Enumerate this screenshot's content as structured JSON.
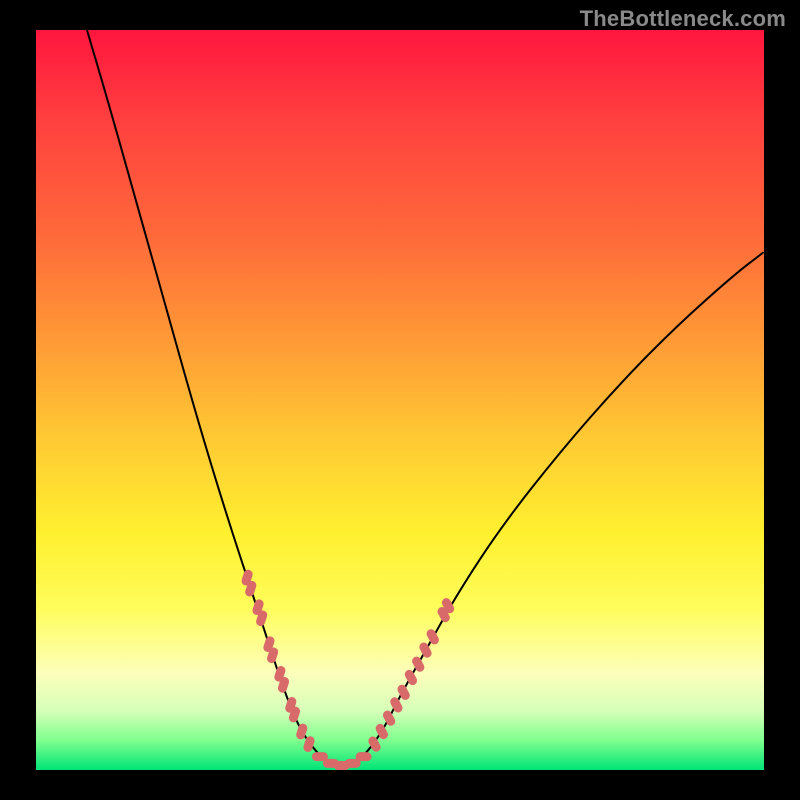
{
  "watermark": {
    "text": "TheBottleneck.com"
  },
  "colors": {
    "curve_stroke": "#000000",
    "marker_fill": "#d86a6a",
    "marker_stroke": "#d86a6a"
  },
  "chart_data": {
    "type": "line",
    "title": "",
    "xlabel": "",
    "ylabel": "",
    "xlim": [
      0,
      100
    ],
    "ylim": [
      0,
      100
    ],
    "curve": [
      {
        "x": 7,
        "y": 100
      },
      {
        "x": 10,
        "y": 90
      },
      {
        "x": 14,
        "y": 76
      },
      {
        "x": 18,
        "y": 62
      },
      {
        "x": 22,
        "y": 48
      },
      {
        "x": 26,
        "y": 35
      },
      {
        "x": 30,
        "y": 23
      },
      {
        "x": 32,
        "y": 17
      },
      {
        "x": 34,
        "y": 11
      },
      {
        "x": 36,
        "y": 6
      },
      {
        "x": 38,
        "y": 3
      },
      {
        "x": 40,
        "y": 1
      },
      {
        "x": 42,
        "y": 0.5
      },
      {
        "x": 44,
        "y": 1
      },
      {
        "x": 46,
        "y": 3
      },
      {
        "x": 48,
        "y": 6
      },
      {
        "x": 50,
        "y": 10
      },
      {
        "x": 54,
        "y": 17
      },
      {
        "x": 58,
        "y": 24
      },
      {
        "x": 64,
        "y": 33
      },
      {
        "x": 72,
        "y": 43
      },
      {
        "x": 80,
        "y": 52
      },
      {
        "x": 88,
        "y": 60
      },
      {
        "x": 96,
        "y": 67
      },
      {
        "x": 100,
        "y": 70
      }
    ],
    "markers": [
      {
        "x": 29,
        "y": 26,
        "shape": "round"
      },
      {
        "x": 29.5,
        "y": 24.5,
        "shape": "round"
      },
      {
        "x": 30.5,
        "y": 22,
        "shape": "round"
      },
      {
        "x": 31,
        "y": 20.5,
        "shape": "round"
      },
      {
        "x": 32,
        "y": 17,
        "shape": "round"
      },
      {
        "x": 32.5,
        "y": 15.5,
        "shape": "round"
      },
      {
        "x": 33.5,
        "y": 13,
        "shape": "round"
      },
      {
        "x": 34,
        "y": 11.5,
        "shape": "round"
      },
      {
        "x": 35,
        "y": 8.8,
        "shape": "round"
      },
      {
        "x": 35.5,
        "y": 7.5,
        "shape": "round"
      },
      {
        "x": 36.5,
        "y": 5.2,
        "shape": "round"
      },
      {
        "x": 37.5,
        "y": 3.5,
        "shape": "round"
      },
      {
        "x": 39,
        "y": 1.8,
        "shape": "round"
      },
      {
        "x": 40.5,
        "y": 0.9,
        "shape": "round"
      },
      {
        "x": 42,
        "y": 0.6,
        "shape": "round"
      },
      {
        "x": 43.5,
        "y": 0.9,
        "shape": "round"
      },
      {
        "x": 45,
        "y": 1.8,
        "shape": "round"
      },
      {
        "x": 46.5,
        "y": 3.5,
        "shape": "round"
      },
      {
        "x": 47.5,
        "y": 5.2,
        "shape": "round"
      },
      {
        "x": 48.5,
        "y": 7,
        "shape": "round"
      },
      {
        "x": 49.5,
        "y": 8.8,
        "shape": "round"
      },
      {
        "x": 50.5,
        "y": 10.5,
        "shape": "round"
      },
      {
        "x": 51.5,
        "y": 12.5,
        "shape": "round"
      },
      {
        "x": 52.5,
        "y": 14.3,
        "shape": "round"
      },
      {
        "x": 53.5,
        "y": 16.2,
        "shape": "round"
      },
      {
        "x": 54.5,
        "y": 18,
        "shape": "round"
      },
      {
        "x": 56,
        "y": 21,
        "shape": "round"
      },
      {
        "x": 56.6,
        "y": 22.2,
        "shape": "round"
      }
    ]
  }
}
